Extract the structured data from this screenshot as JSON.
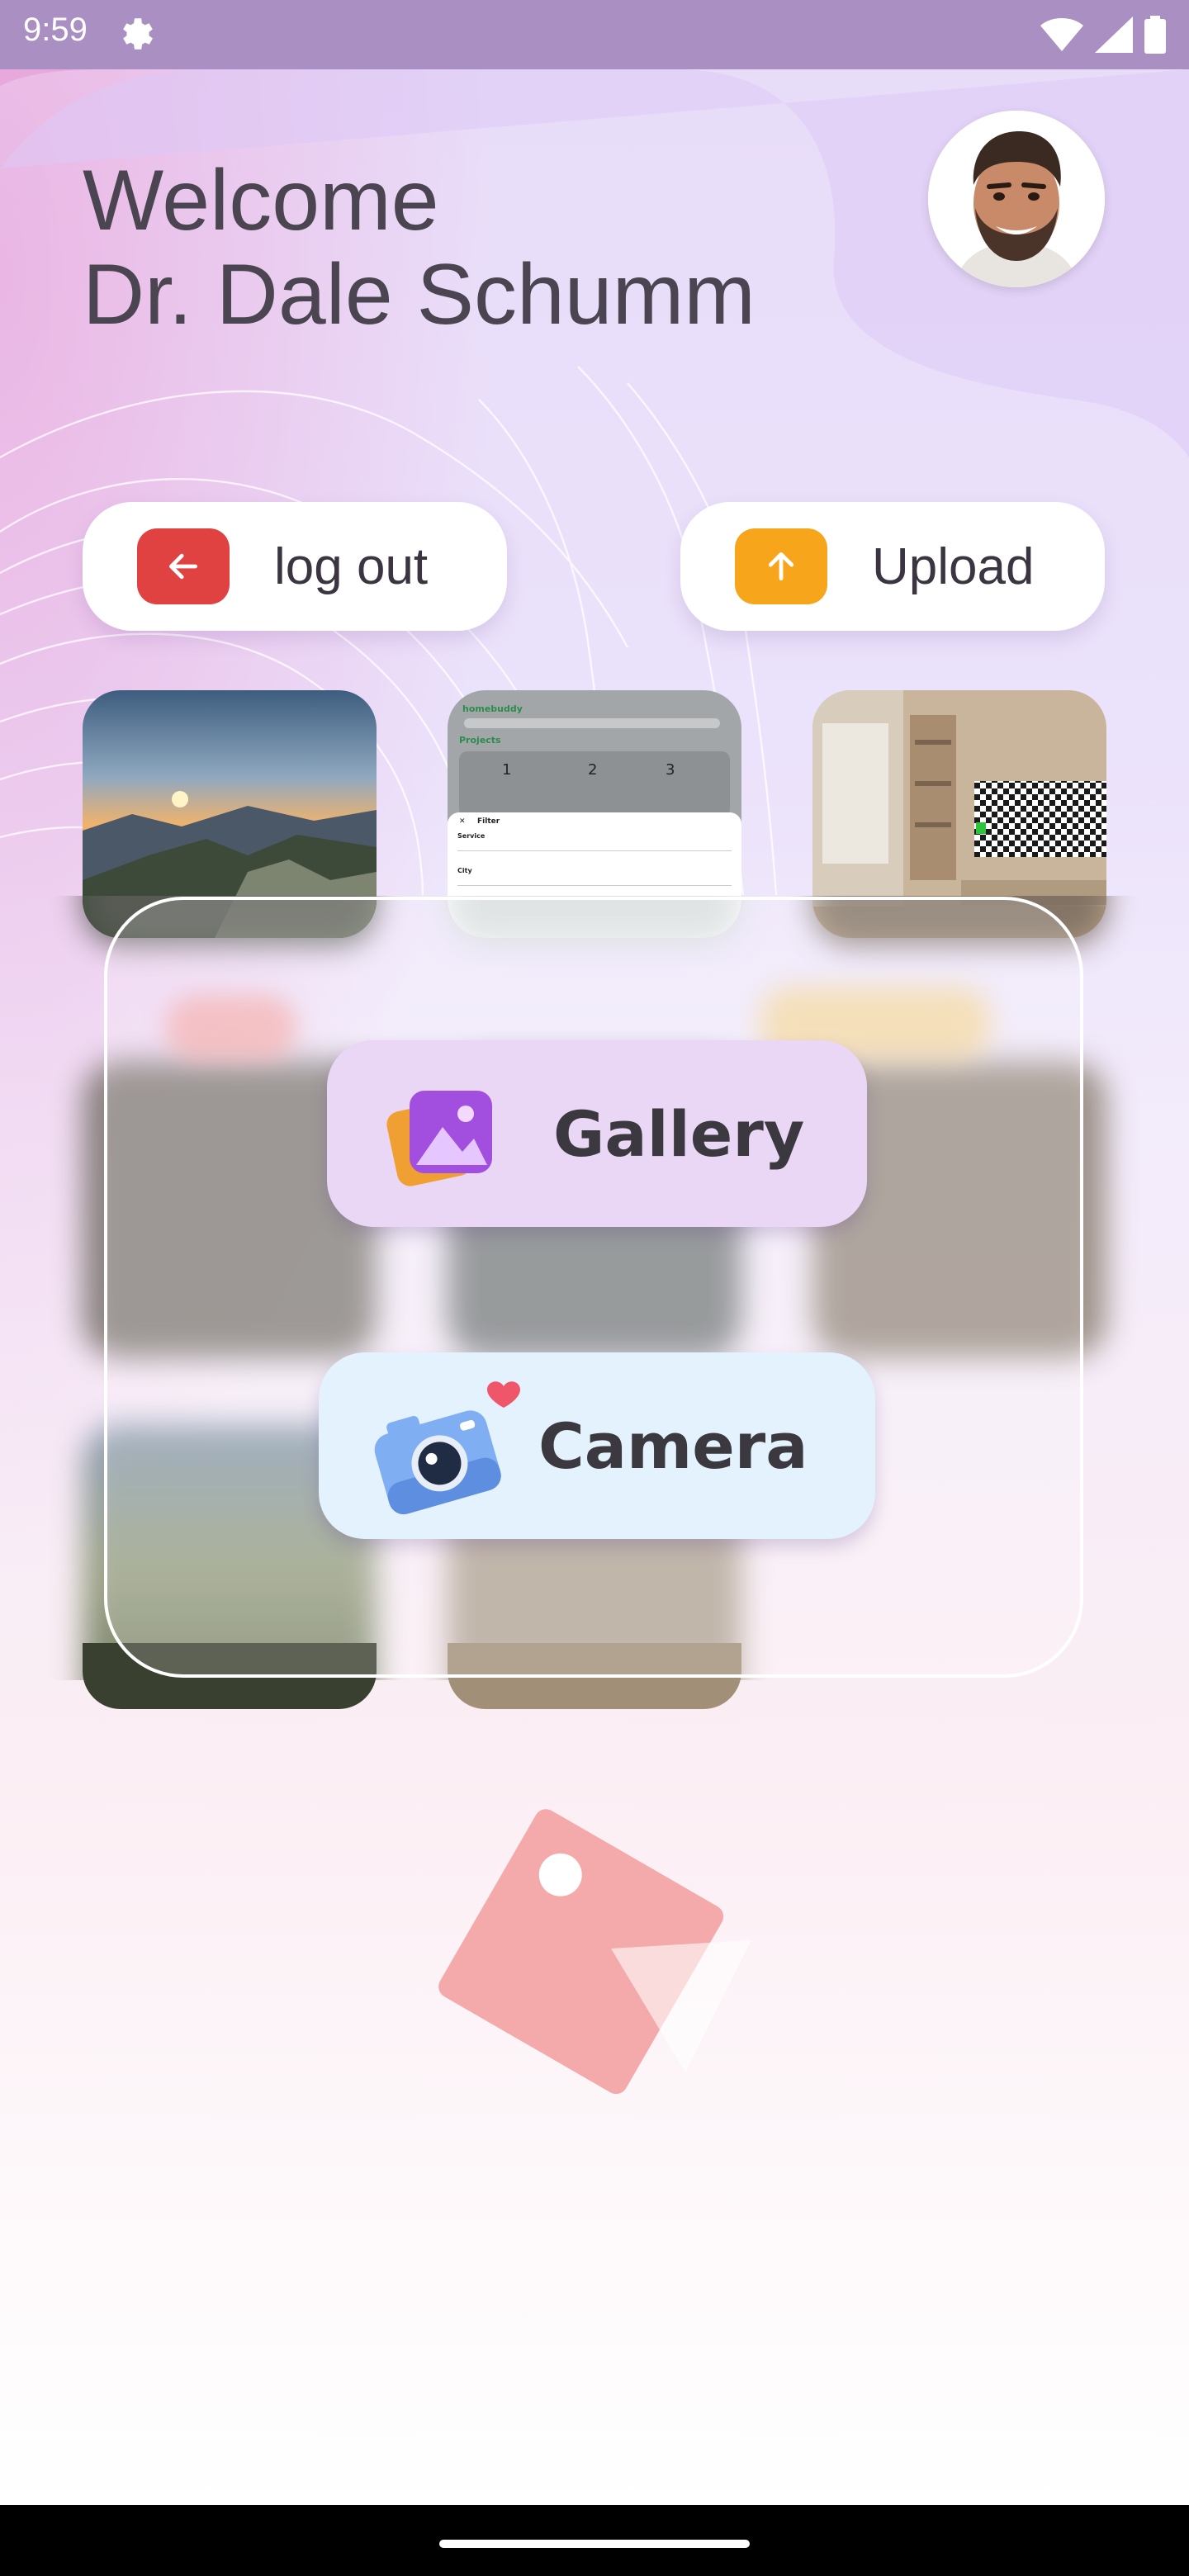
{
  "status_bar": {
    "time": "9:59",
    "icons": [
      "gear-icon",
      "wifi-icon",
      "signal-icon",
      "battery-icon"
    ]
  },
  "header": {
    "welcome_line": "Welcome",
    "user_name": "Dr. Dale Schumm"
  },
  "actions": {
    "logout_label": "log out",
    "upload_label": "Upload"
  },
  "picker": {
    "gallery_label": "Gallery",
    "camera_label": "Camera"
  },
  "thumbnails": {
    "screenshot_app_name": "homebuddy",
    "screenshot_heading": "Projects",
    "screenshot_filter": "Filter",
    "screenshot_service": "Service",
    "screenshot_city": "City"
  },
  "colors": {
    "logout_accent": "#e04242",
    "upload_accent": "#f7a51a",
    "gallery_bg": "#ead7f5",
    "camera_bg": "#e4f2fd"
  }
}
